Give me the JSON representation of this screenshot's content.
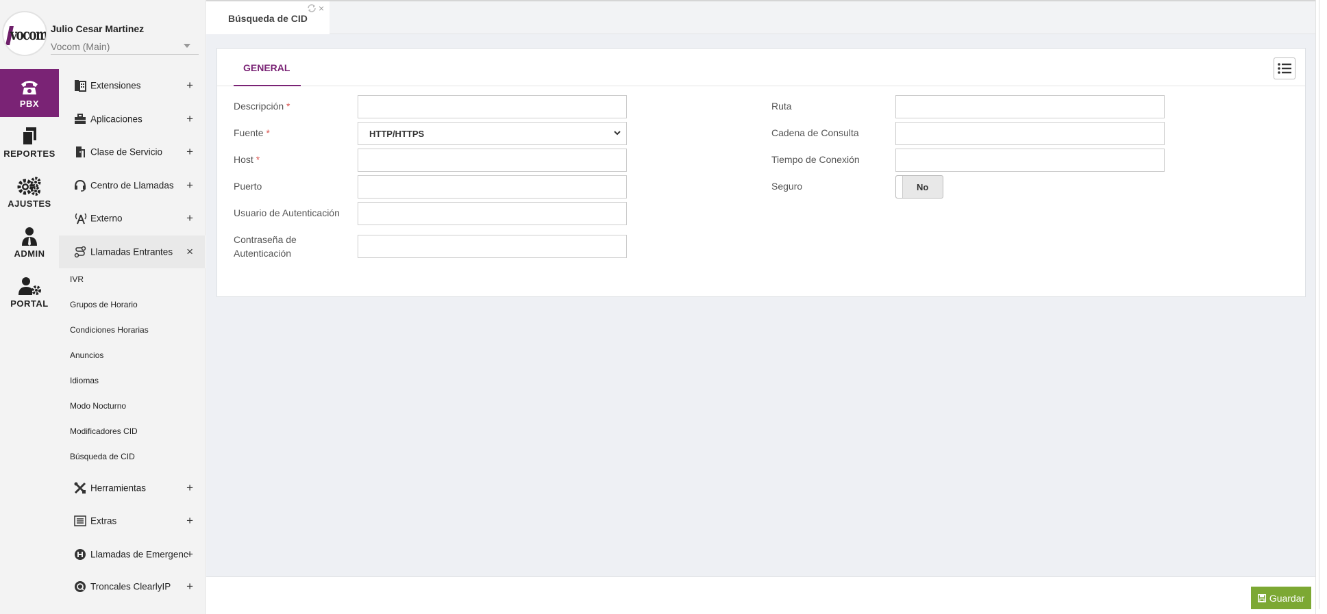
{
  "user": {
    "name": "Julio Cesar Martinez",
    "company": "Vocom (Main)",
    "logo_text": "vocom"
  },
  "rail": [
    {
      "label": "PBX",
      "icon": "phone-icon",
      "active": true
    },
    {
      "label": "REPORTES",
      "icon": "documents-icon"
    },
    {
      "label": "AJUSTES",
      "icon": "gears-icon"
    },
    {
      "label": "ADMIN",
      "icon": "user-tie-icon"
    },
    {
      "label": "PORTAL",
      "icon": "user-gear-icon"
    }
  ],
  "menu": {
    "items": [
      {
        "label": "Extensiones",
        "icon": "phone-book-icon",
        "toggle": "+"
      },
      {
        "label": "Aplicaciones",
        "icon": "briefcase-icon",
        "toggle": "+"
      },
      {
        "label": "Clase de Servicio",
        "icon": "door-icon",
        "toggle": "+"
      },
      {
        "label": "Centro de Llamadas",
        "icon": "headset-icon",
        "toggle": "+"
      },
      {
        "label": "Externo",
        "icon": "antenna-icon",
        "toggle": "+"
      },
      {
        "label": "Llamadas Entrantes",
        "icon": "route-icon",
        "toggle": "×"
      },
      {
        "label": "Herramientas",
        "icon": "tools-icon",
        "toggle": "+"
      },
      {
        "label": "Extras",
        "icon": "list-icon",
        "toggle": "+"
      },
      {
        "label": "Llamadas de Emergencia",
        "icon": "hospital-icon",
        "toggle": "+"
      },
      {
        "label": "Troncales ClearlyIP",
        "icon": "clearlyip-icon",
        "toggle": "+"
      }
    ],
    "subitems": [
      "IVR",
      "Grupos de Horario",
      "Condiciones Horarias",
      "Anuncios",
      "Idiomas",
      "Modo Nocturno",
      "Modificadores CID",
      "Búsqueda de CID"
    ]
  },
  "tabs": {
    "active": "Búsqueda de CID",
    "close": "×"
  },
  "card": {
    "tab": "GENERAL"
  },
  "form": {
    "left": [
      {
        "label": "Descripción",
        "required": "*",
        "value": ""
      },
      {
        "label": "Fuente",
        "required": "*",
        "value": "HTTP/HTTPS"
      },
      {
        "label": "Host",
        "required": "*",
        "value": ""
      },
      {
        "label": "Puerto",
        "value": ""
      },
      {
        "label": "Usuario de Autenticación",
        "value": ""
      },
      {
        "label_line1": "Contraseña de",
        "label_line2": "Autenticación",
        "value": ""
      }
    ],
    "right": [
      {
        "label": "Ruta",
        "value": ""
      },
      {
        "label": "Cadena de Consulta",
        "value": ""
      },
      {
        "label": "Tiempo de Conexión",
        "value": ""
      },
      {
        "label": "Seguro",
        "value": "No"
      }
    ]
  },
  "footer": {
    "save_label": "Guardar"
  },
  "colors": {
    "accent": "#7a2375",
    "save": "#7ca833"
  }
}
